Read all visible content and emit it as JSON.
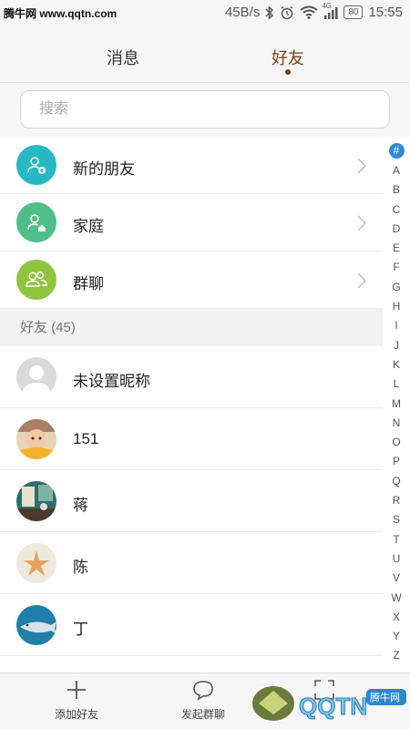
{
  "status_bar": {
    "watermark": "腾牛网 www.qqtn.com",
    "speed": "45B/s",
    "network": "4G",
    "battery": "80",
    "time": "15:55"
  },
  "tabs": [
    {
      "label": "消息",
      "active": false
    },
    {
      "label": "好友",
      "active": true
    }
  ],
  "search": {
    "placeholder": "搜索"
  },
  "functions": [
    {
      "label": "新的朋友",
      "icon": "add-person-icon",
      "color": "#27b8c4"
    },
    {
      "label": "家庭",
      "icon": "family-person-icon",
      "color": "#4fbf8a"
    },
    {
      "label": "群聊",
      "icon": "group-icon",
      "color": "#8fc43f"
    }
  ],
  "friends_section": {
    "label": "好友 (45)"
  },
  "friends": [
    {
      "name": "未设置昵称",
      "avatar": "default-avatar"
    },
    {
      "name": "151",
      "avatar": "baby-photo"
    },
    {
      "name": "蒋",
      "avatar": "room-photo"
    },
    {
      "name": "陈",
      "avatar": "starfish-photo"
    },
    {
      "name": "丁",
      "avatar": "shark-photo"
    }
  ],
  "index_letters": [
    "#",
    "A",
    "B",
    "C",
    "D",
    "E",
    "F",
    "G",
    "H",
    "I",
    "J",
    "K",
    "L",
    "M",
    "N",
    "O",
    "P",
    "Q",
    "R",
    "S",
    "T",
    "U",
    "V",
    "W",
    "X",
    "Y",
    "Z"
  ],
  "bottom_bar": {
    "add_friend": "添加好友",
    "start_group": "发起群聊"
  },
  "corner_logo": {
    "text": "QQTN.com",
    "badge": "腾牛网"
  },
  "colors": {
    "accent": "#7a3e1a",
    "index_active": "#2f8ad1"
  }
}
